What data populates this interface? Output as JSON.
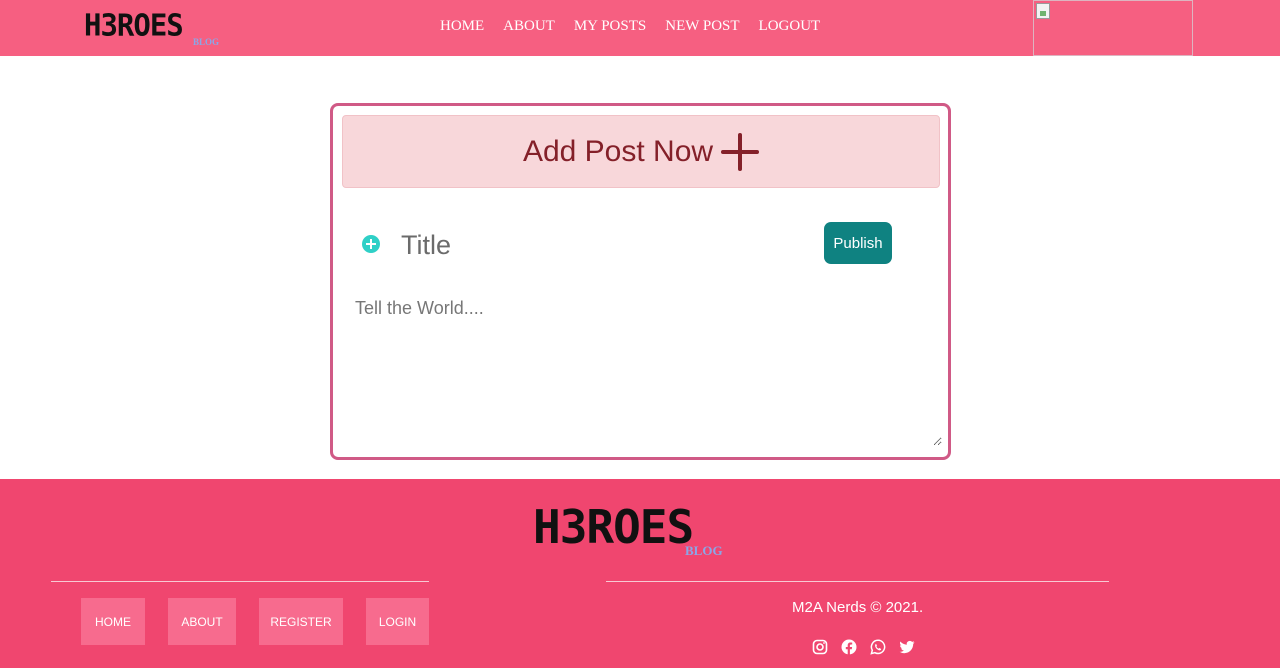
{
  "header": {
    "logo_text": "H3ROES",
    "logo_sub": "BLOG",
    "nav": [
      {
        "label": "HOME"
      },
      {
        "label": "ABOUT"
      },
      {
        "label": "MY POSTS"
      },
      {
        "label": "NEW POST"
      },
      {
        "label": "LOGOUT"
      }
    ],
    "image_placeholder_icon": "broken-image-icon"
  },
  "composer": {
    "banner_title": "Add Post Now",
    "banner_icon": "plus-icon",
    "add_icon": "plus-circle-icon",
    "title_placeholder": "Title",
    "publish_label": "Publish",
    "body_placeholder": "Tell the World...."
  },
  "footer": {
    "logo_text": "H3ROES",
    "logo_sub": "BLOG",
    "nav": [
      {
        "label": "HOME"
      },
      {
        "label": "ABOUT"
      },
      {
        "label": "REGISTER"
      },
      {
        "label": "LOGIN"
      }
    ],
    "copyright": "M2A Nerds © 2021.",
    "social_icons": [
      "instagram-icon",
      "facebook-icon",
      "whatsapp-icon",
      "twitter-icon"
    ]
  },
  "colors": {
    "header_bg": "#f65f81",
    "footer_bg": "#f0466f",
    "card_border": "#d05a86",
    "banner_bg": "#f8d7da",
    "banner_text": "#842029",
    "publish_bg": "#0f8281",
    "add_icon": "#2fd0c7"
  }
}
